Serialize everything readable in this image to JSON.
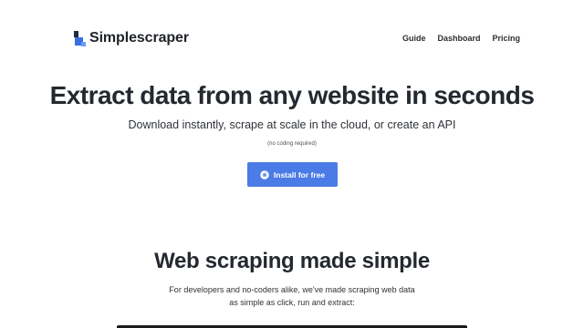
{
  "brand": {
    "name": "Simplescraper",
    "logo_icon": "simplescraper-logo-icon"
  },
  "nav": {
    "links": [
      "Guide",
      "Dashboard",
      "Pricing"
    ]
  },
  "hero": {
    "title": "Extract data from any website in seconds",
    "subtitle": "Download instantly, scrape at scale in the cloud, or create an API",
    "note": "(no coding required)",
    "cta_label": "Install for free",
    "cta_icon": "chrome-icon",
    "cta_color": "#4b7be5"
  },
  "section": {
    "title": "Web scraping made simple",
    "text_line1": "For developers and no-coders alike, we've made scraping web data",
    "text_line2": "as simple as click, run and extract:"
  },
  "colors": {
    "accent": "#4b7be5",
    "text": "#24292f",
    "background": "#ffffff"
  }
}
